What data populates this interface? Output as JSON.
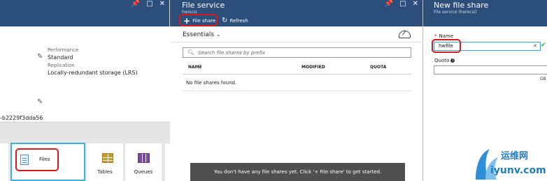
{
  "blade1": {
    "performance_label": "Performance",
    "performance_value": "Standard",
    "replication_label": "Replication",
    "replication_value": "Locally-redundant storage (LRS)",
    "key_fragment": "-b2229f3dda56",
    "tiles": [
      {
        "label": "Files",
        "icon": "file-icon"
      },
      {
        "label": "Tables",
        "icon": "table-icon"
      },
      {
        "label": "Queues",
        "icon": "queue-icon"
      }
    ]
  },
  "blade2": {
    "title": "File service",
    "subtitle": "hwiscsi",
    "commands": {
      "file_share": "File share",
      "refresh": "Refresh"
    },
    "essentials_label": "Essentials",
    "search_placeholder": "Search file shares by prefix",
    "columns": [
      "NAME",
      "MODIFIED",
      "QUOTA"
    ],
    "empty_text": "No file shares found.",
    "toast_text": "You don't have any file shares yet. Click '+ File share' to get started."
  },
  "blade3": {
    "title": "New file share",
    "subtitle": "File service (hwiscsi)",
    "name_label": "Name",
    "name_value": "hwfile",
    "quota_label": "Quota",
    "quota_unit": "GB"
  },
  "header_icons": {
    "pin": "✎",
    "maximize": "□",
    "close": "✕"
  },
  "watermark": {
    "cn": "运维网",
    "en": "iyunv.com"
  },
  "colors": {
    "header": "#2b4f7a",
    "callout": "#d81a1a",
    "accent": "#3cb2dc"
  }
}
